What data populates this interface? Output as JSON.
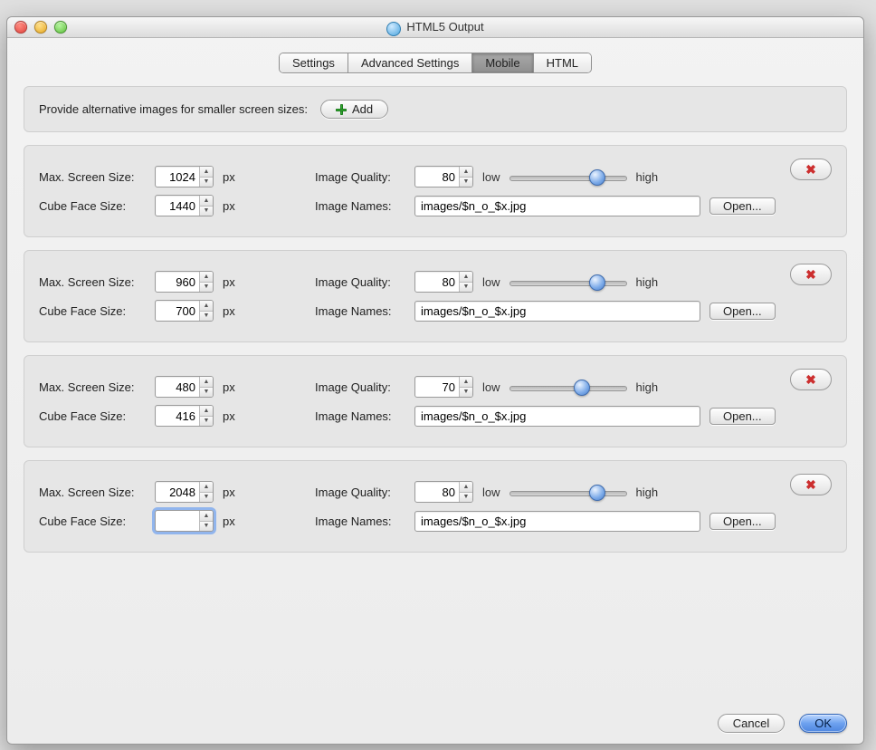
{
  "window": {
    "title": "HTML5 Output"
  },
  "tabs": {
    "items": [
      "Settings",
      "Advanced Settings",
      "Mobile",
      "HTML"
    ],
    "active_index": 2
  },
  "instruction": "Provide alternative images for smaller screen sizes:",
  "add_button": "Add",
  "labels": {
    "max_screen": "Max. Screen Size:",
    "cube_face": "Cube Face Size:",
    "image_quality": "Image Quality:",
    "image_names": "Image Names:",
    "px": "px",
    "low": "low",
    "high": "high",
    "open": "Open..."
  },
  "entries": [
    {
      "max_screen": "1024",
      "cube_face": "1440",
      "quality": "80",
      "slider_pct": 75,
      "names": "images/$n_o_$x.jpg",
      "cube_focused": false
    },
    {
      "max_screen": "960",
      "cube_face": "700",
      "quality": "80",
      "slider_pct": 75,
      "names": "images/$n_o_$x.jpg",
      "cube_focused": false
    },
    {
      "max_screen": "480",
      "cube_face": "416",
      "quality": "70",
      "slider_pct": 62,
      "names": "images/$n_o_$x.jpg",
      "cube_focused": false
    },
    {
      "max_screen": "2048",
      "cube_face": "",
      "quality": "80",
      "slider_pct": 75,
      "names": "images/$n_o_$x.jpg",
      "cube_focused": true
    }
  ],
  "buttons": {
    "cancel": "Cancel",
    "ok": "OK"
  }
}
